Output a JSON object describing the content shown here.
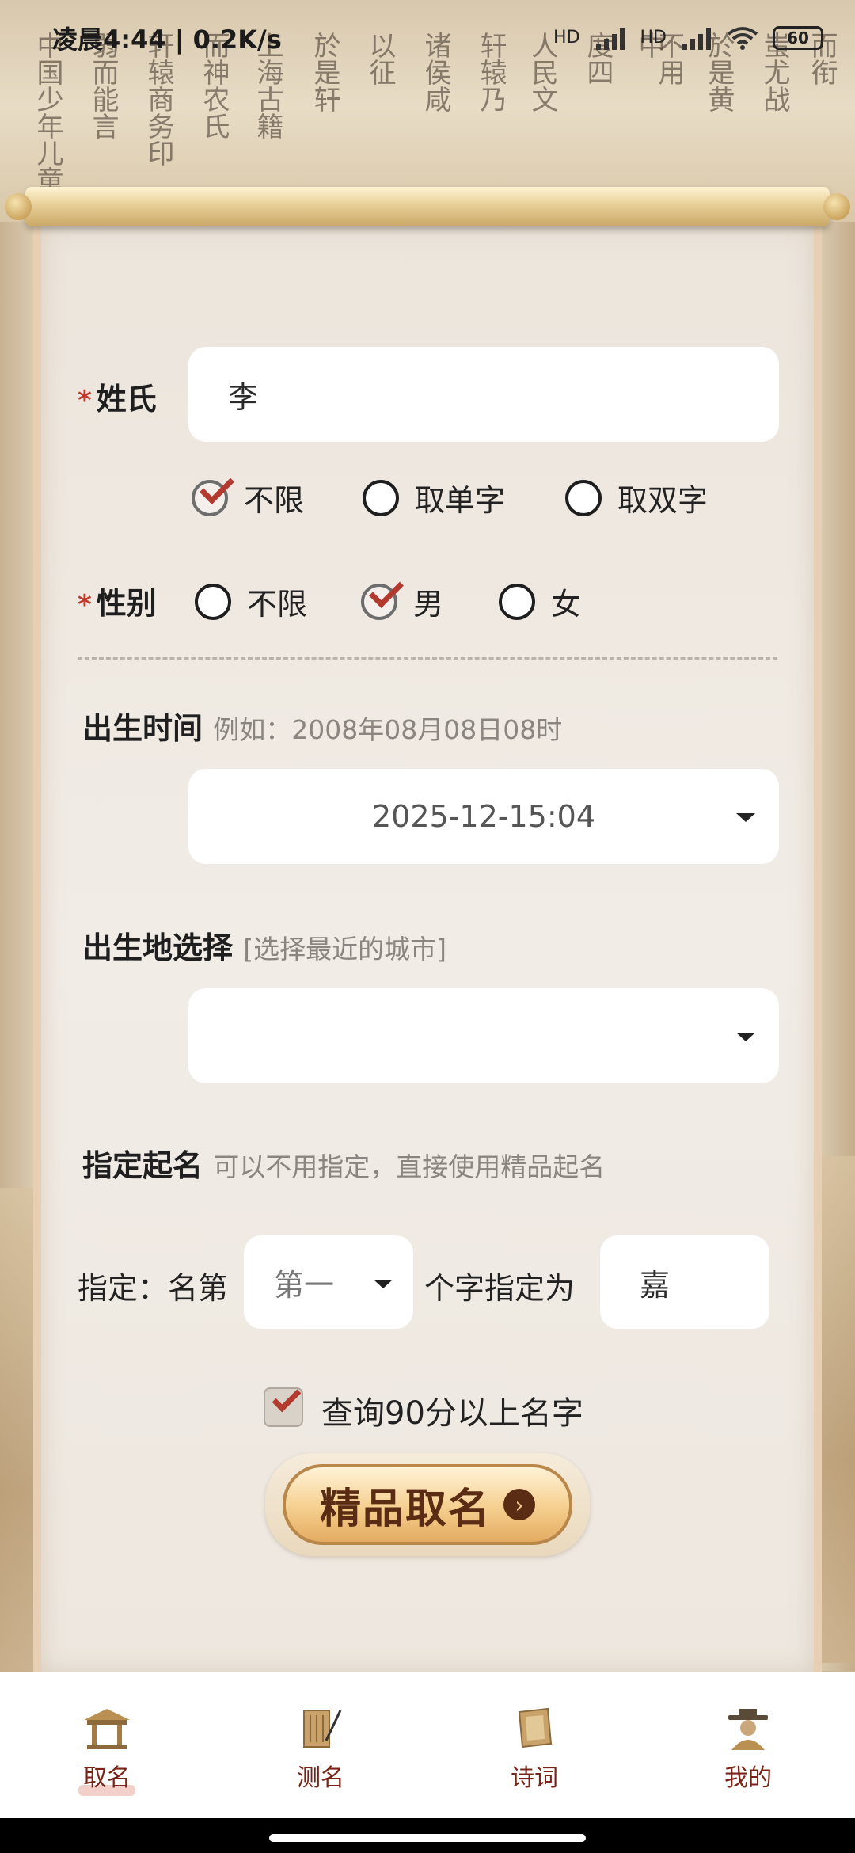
{
  "status_bar": {
    "time": "凌晨4:44 | 0.2K/s",
    "net1": "HD",
    "net2": "HD",
    "battery": "60"
  },
  "background": {
    "columns": [
      "中国少年儿童",
      "弱而能言",
      "轩辕商务印",
      "而神农氏",
      "上海古籍",
      "於是轩",
      "以征",
      "诸侯咸",
      "轩辕乃",
      "人民文",
      "度四",
      "中",
      "不用",
      "於是黄",
      "蚩尤战",
      "而衔"
    ]
  },
  "form": {
    "surname": {
      "label": "姓氏",
      "value": "李"
    },
    "name_length": {
      "options": [
        "不限",
        "取单字",
        "取双字"
      ],
      "selected": 0
    },
    "gender": {
      "label": "性别",
      "options": [
        "不限",
        "男",
        "女"
      ],
      "selected": 1
    },
    "birth_time": {
      "label": "出生时间",
      "hint": "例如：2008年08月08日08时",
      "value": "2025-12-15:04"
    },
    "birth_place": {
      "label": "出生地选择",
      "hint": "[选择最近的城市]",
      "value": ""
    },
    "specify": {
      "label": "指定起名",
      "hint": "可以不用指定，直接使用精品起名",
      "prefix": "指定：名第",
      "position_value": "第一",
      "middle": "个字指定为",
      "char_value": "嘉"
    },
    "score_filter": {
      "label": "查询90分以上名字",
      "checked": true
    },
    "submit_label": "精品取名",
    "submit_arrow": "›"
  },
  "nav": {
    "items": [
      {
        "label": "取名",
        "icon": "pavilion-icon",
        "active": true
      },
      {
        "label": "测名",
        "icon": "scroll-brush-icon",
        "active": false
      },
      {
        "label": "诗词",
        "icon": "book-scroll-icon",
        "active": false
      },
      {
        "label": "我的",
        "icon": "scholar-avatar-icon",
        "active": false
      }
    ]
  },
  "colors": {
    "accent_red": "#b23a2f",
    "nav_label": "#7a2418",
    "cta_text": "#5b2c14"
  }
}
